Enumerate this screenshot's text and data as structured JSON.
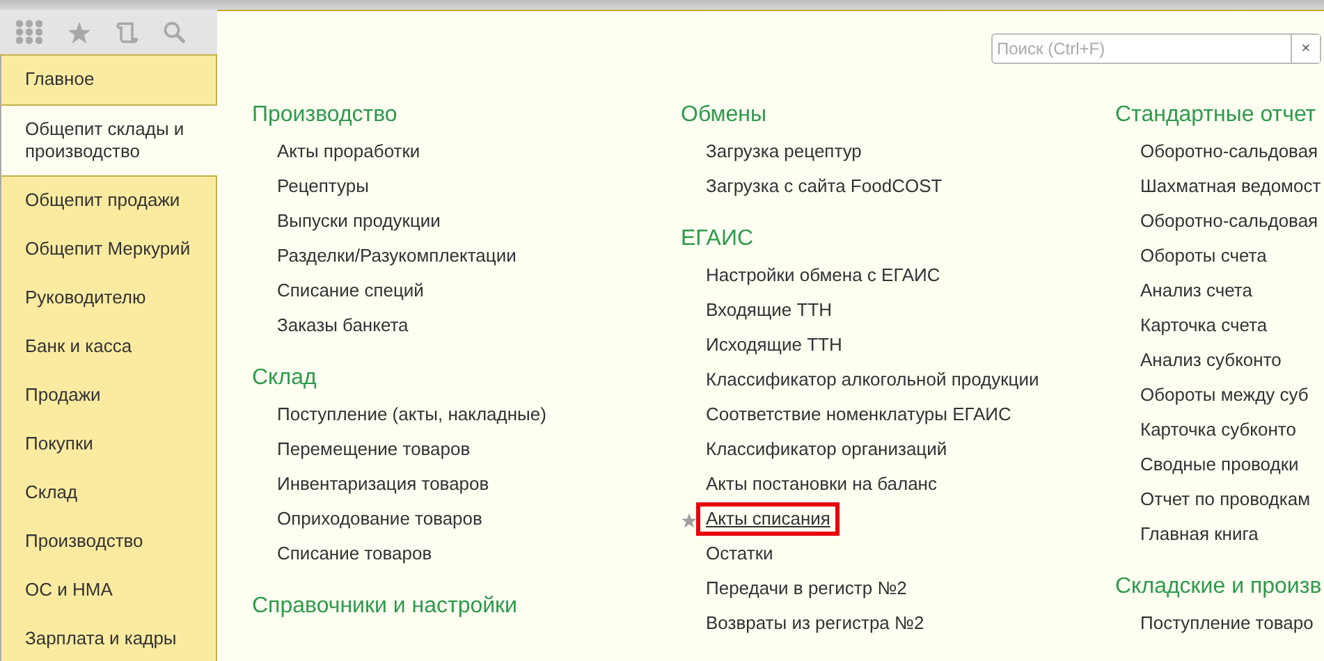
{
  "sidebar": {
    "items": [
      {
        "label": "Главное",
        "selected": false
      },
      {
        "label": "Общепит склады и производство",
        "selected": true
      },
      {
        "label": "Общепит продажи",
        "selected": false
      },
      {
        "label": "Общепит Меркурий",
        "selected": false
      },
      {
        "label": "Руководителю",
        "selected": false
      },
      {
        "label": "Банк и касса",
        "selected": false
      },
      {
        "label": "Продажи",
        "selected": false
      },
      {
        "label": "Покупки",
        "selected": false
      },
      {
        "label": "Склад",
        "selected": false
      },
      {
        "label": "Производство",
        "selected": false
      },
      {
        "label": "ОС и НМА",
        "selected": false
      },
      {
        "label": "Зарплата и кадры",
        "selected": false
      }
    ]
  },
  "search": {
    "placeholder": "Поиск (Ctrl+F)",
    "clear": "×"
  },
  "columns": [
    [
      {
        "title": "Производство",
        "items": [
          {
            "label": "Акты проработки",
            "starred": false,
            "highlighted": false
          },
          {
            "label": "Рецептуры",
            "starred": false,
            "highlighted": false
          },
          {
            "label": "Выпуски продукции",
            "starred": false,
            "highlighted": false
          },
          {
            "label": "Разделки/Разукомплектации",
            "starred": false,
            "highlighted": false
          },
          {
            "label": "Списание специй",
            "starred": false,
            "highlighted": false
          },
          {
            "label": "Заказы банкета",
            "starred": false,
            "highlighted": false
          }
        ]
      },
      {
        "title": "Склад",
        "items": [
          {
            "label": "Поступление (акты, накладные)",
            "starred": false,
            "highlighted": false
          },
          {
            "label": "Перемещение товаров",
            "starred": false,
            "highlighted": false
          },
          {
            "label": "Инвентаризация товаров",
            "starred": false,
            "highlighted": false
          },
          {
            "label": "Оприходование товаров",
            "starred": false,
            "highlighted": false
          },
          {
            "label": "Списание товаров",
            "starred": false,
            "highlighted": false
          }
        ]
      },
      {
        "title": "Справочники и настройки"
      }
    ],
    [
      {
        "title": "Обмены",
        "items": [
          {
            "label": "Загрузка рецептур",
            "starred": false,
            "highlighted": false
          },
          {
            "label": "Загрузка с сайта FoodCOST",
            "starred": false,
            "highlighted": false
          }
        ]
      },
      {
        "title": "ЕГАИС",
        "items": [
          {
            "label": "Настройки обмена с ЕГАИС",
            "starred": false,
            "highlighted": false
          },
          {
            "label": "Входящие ТТН",
            "starred": false,
            "highlighted": false
          },
          {
            "label": "Исходящие ТТН",
            "starred": false,
            "highlighted": false
          },
          {
            "label": "Классификатор алкогольной продукции",
            "starred": false,
            "highlighted": false
          },
          {
            "label": "Соответствие номенклатуры ЕГАИС",
            "starred": false,
            "highlighted": false
          },
          {
            "label": "Классификатор организаций",
            "starred": false,
            "highlighted": false
          },
          {
            "label": "Акты постановки на баланс",
            "starred": false,
            "highlighted": false
          },
          {
            "label": "Акты списания",
            "starred": true,
            "highlighted": true
          },
          {
            "label": "Остатки",
            "starred": false,
            "highlighted": false
          },
          {
            "label": "Передачи в регистр №2",
            "starred": false,
            "highlighted": false
          },
          {
            "label": "Возвраты из регистра №2",
            "starred": false,
            "highlighted": false
          }
        ]
      }
    ],
    [
      {
        "title": "Стандартные отчет",
        "items": [
          {
            "label": "Оборотно-сальдовая",
            "starred": false,
            "highlighted": false
          },
          {
            "label": "Шахматная ведомост",
            "starred": false,
            "highlighted": false
          },
          {
            "label": "Оборотно-сальдовая",
            "starred": false,
            "highlighted": false
          },
          {
            "label": "Обороты счета",
            "starred": false,
            "highlighted": false
          },
          {
            "label": "Анализ счета",
            "starred": false,
            "highlighted": false
          },
          {
            "label": "Карточка счета",
            "starred": false,
            "highlighted": false
          },
          {
            "label": "Анализ субконто",
            "starred": false,
            "highlighted": false
          },
          {
            "label": "Обороты между суб",
            "starred": false,
            "highlighted": false
          },
          {
            "label": "Карточка субконто",
            "starred": false,
            "highlighted": false
          },
          {
            "label": "Сводные проводки",
            "starred": false,
            "highlighted": false
          },
          {
            "label": "Отчет по проводкам",
            "starred": false,
            "highlighted": false
          },
          {
            "label": "Главная книга",
            "starred": false,
            "highlighted": false
          }
        ]
      },
      {
        "title": "Складские и произв",
        "items": [
          {
            "label": "Поступление товаро",
            "starred": false,
            "highlighted": false
          }
        ]
      }
    ]
  ]
}
